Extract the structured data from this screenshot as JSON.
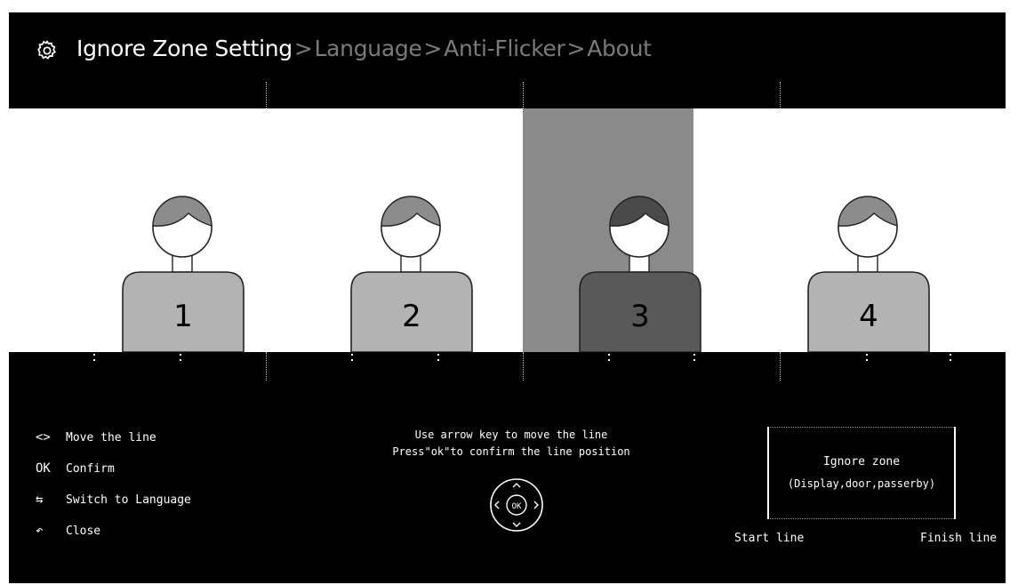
{
  "header": {
    "crumbs": [
      {
        "label": "Ignore Zone Setting",
        "active": true
      },
      {
        "label": "Language",
        "active": false
      },
      {
        "label": "Anti-Flicker",
        "active": false
      },
      {
        "label": "About",
        "active": false
      }
    ],
    "separator": ">"
  },
  "people": [
    {
      "number": "1",
      "selected": false
    },
    {
      "number": "2",
      "selected": false
    },
    {
      "number": "3",
      "selected": true
    },
    {
      "number": "4",
      "selected": false
    }
  ],
  "help": [
    {
      "icon": "<>",
      "icon_name": "arrows-icon",
      "label": "Move the line"
    },
    {
      "icon": "OK",
      "icon_name": "ok-icon",
      "label": "Confirm"
    },
    {
      "icon": "⇆",
      "icon_name": "switch-icon",
      "label": "Switch to Language"
    },
    {
      "icon": "↶",
      "icon_name": "back-icon",
      "label": "Close"
    }
  ],
  "instructions": {
    "line1": "Use arrow key to move the line",
    "line2": "Press\"ok\"to confirm the line position"
  },
  "dpad": {
    "center": "OK"
  },
  "zone_box": {
    "title": "Ignore zone",
    "description": "(Display,door,passerby)",
    "start_label": "Start line",
    "finish_label": "Finish line"
  },
  "colors": {
    "background": "#000000",
    "scene": "#ffffff",
    "selected_zone": "#8a8a8a",
    "inactive_crumb": "#7a7a7a"
  }
}
